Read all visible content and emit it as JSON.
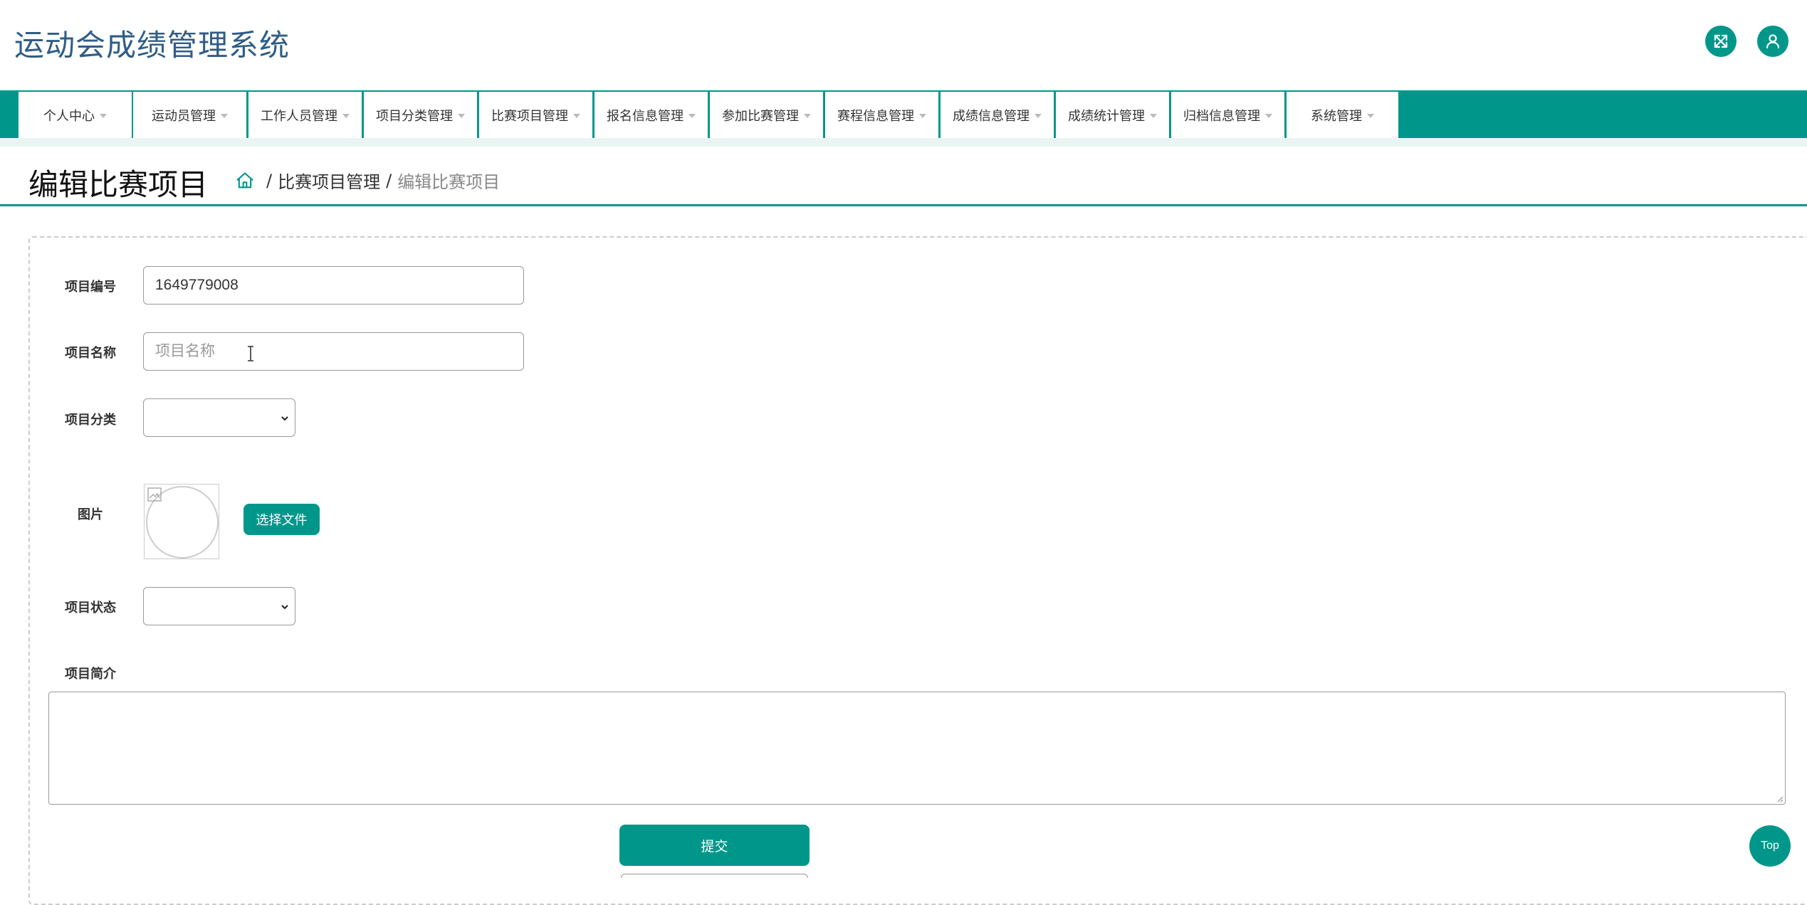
{
  "header": {
    "app_title": "运动会成绩管理系统",
    "icons": {
      "fullscreen": "fullscreen-icon",
      "user": "user-icon"
    }
  },
  "nav": {
    "items": [
      {
        "label": "个人中心"
      },
      {
        "label": "运动员管理"
      },
      {
        "label": "工作人员管理"
      },
      {
        "label": "项目分类管理"
      },
      {
        "label": "比赛项目管理"
      },
      {
        "label": "报名信息管理"
      },
      {
        "label": "参加比赛管理"
      },
      {
        "label": "赛程信息管理"
      },
      {
        "label": "成绩信息管理"
      },
      {
        "label": "成绩统计管理"
      },
      {
        "label": "归档信息管理"
      },
      {
        "label": "系统管理"
      }
    ]
  },
  "page": {
    "title": "编辑比赛项目",
    "breadcrumb": {
      "home_icon": "home-icon",
      "sep1": "/",
      "parent": "比赛项目管理",
      "sep2": "/",
      "current": "编辑比赛项目"
    }
  },
  "form": {
    "code": {
      "label": "项目编号",
      "value": "1649779008"
    },
    "name": {
      "label": "项目名称",
      "value": "",
      "placeholder": "项目名称"
    },
    "category": {
      "label": "项目分类",
      "value": ""
    },
    "image": {
      "label": "图片",
      "button": "选择文件"
    },
    "status": {
      "label": "项目状态",
      "value": ""
    },
    "intro": {
      "label": "项目简介",
      "value": ""
    },
    "submit": "提交"
  },
  "top_button": "Top",
  "colors": {
    "accent": "#00978a",
    "title_blue": "#2f5d86",
    "nav_gap": "#eaf4f2"
  }
}
